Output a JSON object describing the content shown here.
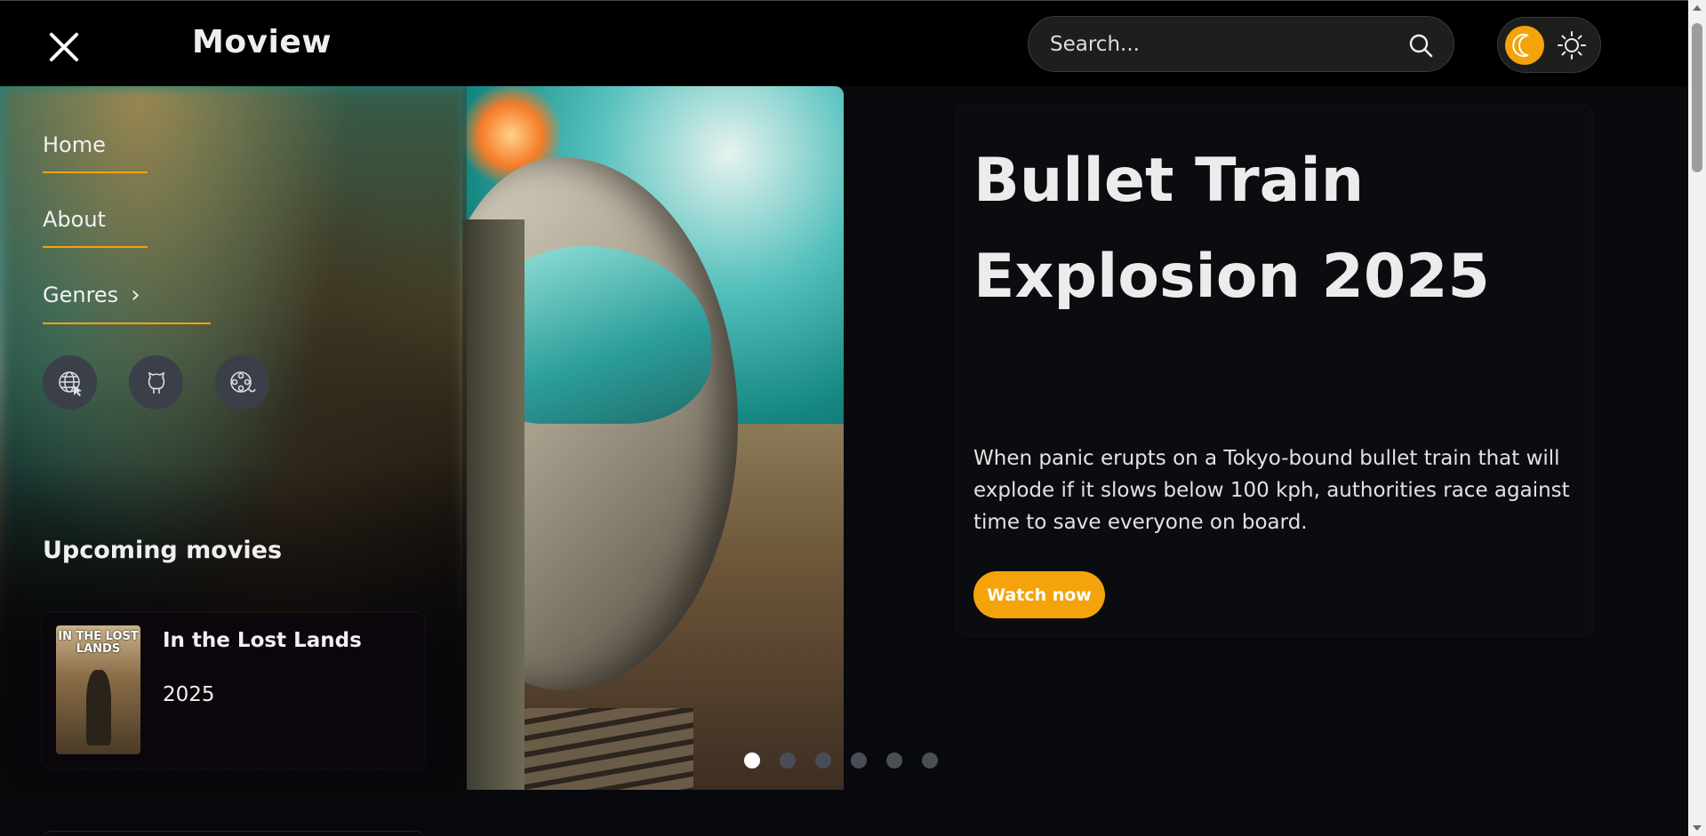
{
  "header": {
    "logo": "Moview",
    "search_placeholder": "Search..."
  },
  "sidebar": {
    "nav": [
      {
        "label": "Home"
      },
      {
        "label": "About"
      },
      {
        "label": "Genres"
      }
    ],
    "icons": [
      "globe-cursor-icon",
      "github-icon",
      "film-reel-icon"
    ],
    "upcoming_title": "Upcoming movies",
    "upcoming": [
      {
        "title": "In the Lost Lands",
        "year": "2025",
        "poster_text": "IN THE LOST LANDS"
      }
    ]
  },
  "hero": {
    "title": "Bullet Train Explosion 2025",
    "description": "When panic erupts on a Tokyo-bound bullet train that will explode if it slows below 100 kph, authorities race against time to save everyone on board.",
    "watch_label": "Watch now",
    "slides": 6,
    "active_slide": 1
  },
  "colors": {
    "accent": "#f5a30b",
    "background": "#07090c",
    "topbar": "#000000"
  }
}
